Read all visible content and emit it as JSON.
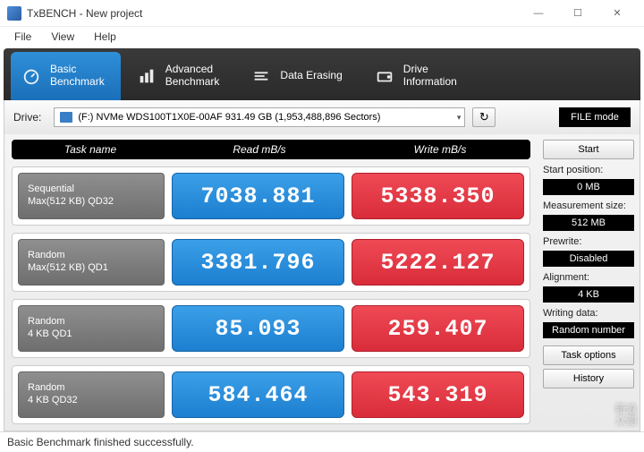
{
  "window": {
    "title": "TxBENCH - New project",
    "min": "—",
    "max": "☐",
    "close": "✕"
  },
  "menu": {
    "file": "File",
    "view": "View",
    "help": "Help"
  },
  "tabs": {
    "basic": "Basic\nBenchmark",
    "advanced": "Advanced\nBenchmark",
    "erase": "Data Erasing",
    "drive": "Drive\nInformation"
  },
  "toolbar": {
    "drive_label": "Drive:",
    "drive_text": "(F:) NVMe WDS100T1X0E-00AF  931.49 GB (1,953,488,896 Sectors)",
    "reload": "↻",
    "filemode": "FILE mode"
  },
  "headers": {
    "task": "Task name",
    "read": "Read mB/s",
    "write": "Write mB/s"
  },
  "rows": [
    {
      "name": "Sequential\nMax(512 KB) QD32",
      "read": "7038.881",
      "write": "5338.350"
    },
    {
      "name": "Random\nMax(512 KB) QD1",
      "read": "3381.796",
      "write": "5222.127"
    },
    {
      "name": "Random\n4 KB QD1",
      "read": "85.093",
      "write": "259.407"
    },
    {
      "name": "Random\n4 KB QD32",
      "read": "584.464",
      "write": "543.319"
    }
  ],
  "sidebar": {
    "start": "Start",
    "start_pos_label": "Start position:",
    "start_pos": "0 MB",
    "meas_label": "Measurement size:",
    "meas": "512 MB",
    "prewrite_label": "Prewrite:",
    "prewrite": "Disabled",
    "align_label": "Alignment:",
    "align": "4 KB",
    "writedata_label": "Writing data:",
    "writedata": "Random number",
    "taskopt": "Task options",
    "history": "History"
  },
  "status": "Basic Benchmark finished successfully.",
  "watermark": "新浪\n众测"
}
